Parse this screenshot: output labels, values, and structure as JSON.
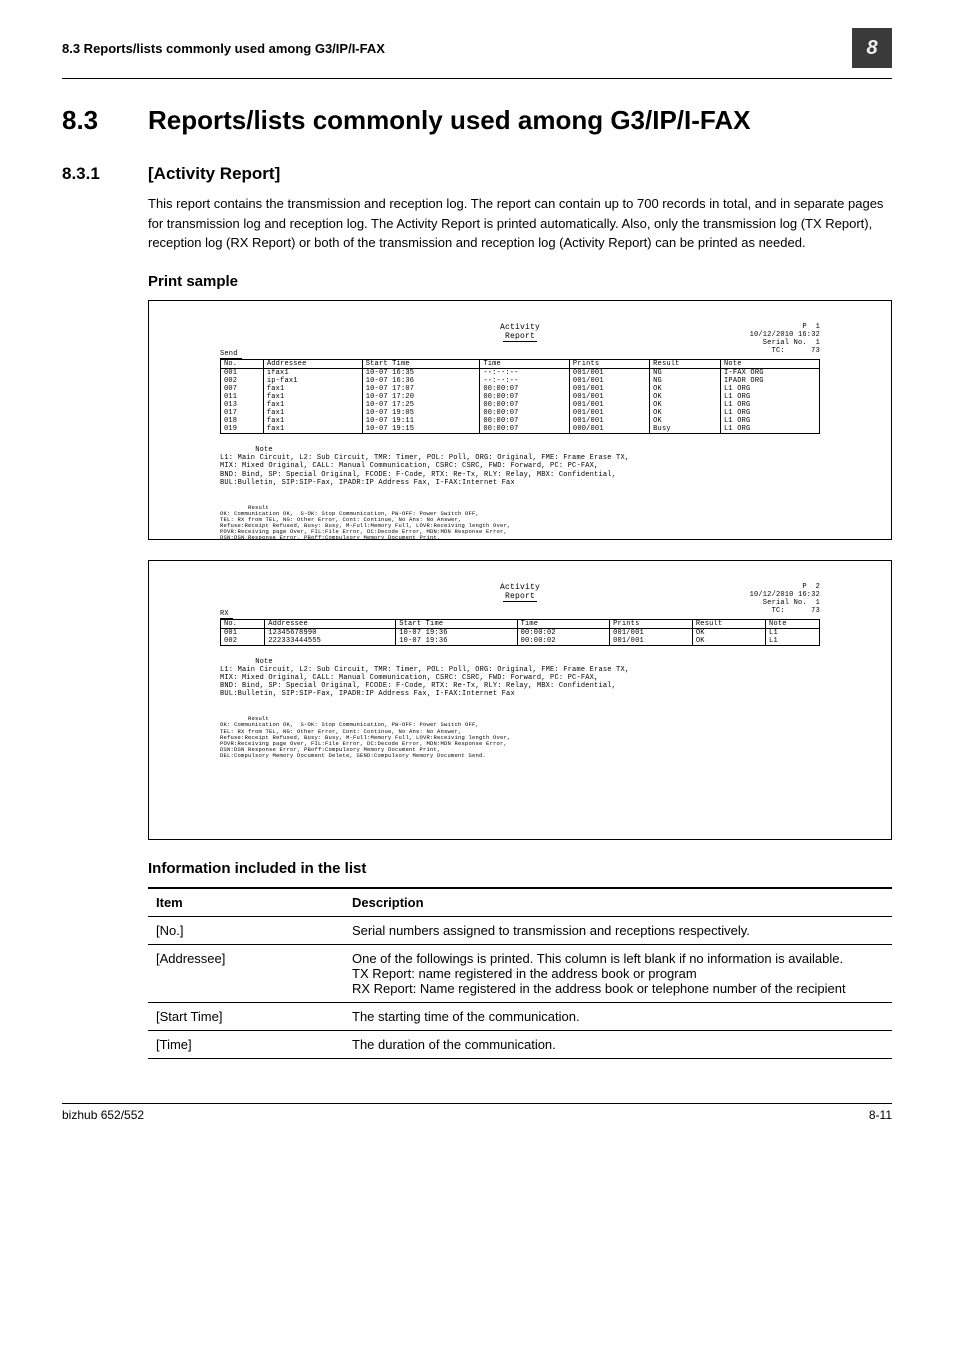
{
  "header": {
    "running": "8.3    Reports/lists commonly used among G3/IP/I-FAX",
    "chapter_box": "8"
  },
  "title": {
    "num": "8.3",
    "text": "Reports/lists commonly used among G3/IP/I-FAX"
  },
  "sub": {
    "num": "8.3.1",
    "text": "[Activity Report]"
  },
  "para1": "This report contains the transmission and reception log. The report can contain up to 700 records in total, and in separate pages for transmission log and reception log. The Activity Report is printed automatically. Also, only the transmission log (TX Report), reception log (RX Report) or both of the transmission and reception log (Activity Report) can be printed as needed.",
  "print_sample_heading": "Print sample",
  "report_common": {
    "title_top": "Activity",
    "title_bottom": "Report",
    "legend_note": "L1: Main Circuit, L2: Sub Circuit, TMR: Timer, POL: Poll, ORG: Original, FME: Frame Erase TX,\nMIX: Mixed Original, CALL: Manual Communication, CSRC: CSRC, FWD: Forward, PC: PC-FAX,\nBND: Bind, SP: Special Original, FCODE: F-Code, RTX: Re-Tx, RLY: Relay, MBX: Confidential,\nBUL:Bulletin, SIP:SIP-Fax, IPADR:IP Address Fax, I-FAX:Internet Fax",
    "legend_result": "OK: Communication OK,  S-OK: Stop Communication, PW-OFF: Power Switch OFF,\nTEL: RX from TEL, NG: Other Error, Cont: Continue, No Ans: No Answer,\nRefuse:Receipt Refused, Busy: Busy, M-Full:Memory Full, LOVR:Receiving length Over,\nPOVR:Receiving page Over, FIL:File Error, DC:Decode Error, MDN:MDN Response Error,\nDSN:DSN Response Error, PBoff:Compulsory Memory Document Print,\nDEL:Compulsory Memory Document Delete, SEND:Compulsory Memory Document Send.",
    "cols": [
      "No.",
      "Addressee",
      "Start Time",
      "Time",
      "Prints",
      "Result",
      "Note"
    ],
    "note_label": "Note",
    "result_label": "Result"
  },
  "report1": {
    "meta": "P  1\n10/12/2010 16:32\nSerial No.  1\nTC:      73",
    "section": "Send",
    "rows": [
      {
        "no": "001",
        "addr": "ifax1",
        "start": "10-07 16:35",
        "time": "--:--:--",
        "prints": "001/001",
        "result": "NG",
        "note": "I-FAX ORG"
      },
      {
        "no": "002",
        "addr": "ip-fax1",
        "start": "10-07 16:36",
        "time": "--:--:--",
        "prints": "001/001",
        "result": "NG",
        "note": "IPADR ORG"
      },
      {
        "no": "007",
        "addr": "fax1",
        "start": "10-07 17:07",
        "time": "00:00:07",
        "prints": "001/001",
        "result": "OK",
        "note": "L1 ORG"
      },
      {
        "no": "011",
        "addr": "fax1",
        "start": "10-07 17:20",
        "time": "00:00:07",
        "prints": "001/001",
        "result": "OK",
        "note": "L1 ORG"
      },
      {
        "no": "013",
        "addr": "fax1",
        "start": "10-07 17:25",
        "time": "00:00:07",
        "prints": "001/001",
        "result": "OK",
        "note": "L1 ORG"
      },
      {
        "no": "017",
        "addr": "fax1",
        "start": "10-07 19:05",
        "time": "00:00:07",
        "prints": "001/001",
        "result": "OK",
        "note": "L1 ORG"
      },
      {
        "no": "018",
        "addr": "fax1",
        "start": "10-07 19:11",
        "time": "00:00:07",
        "prints": "001/001",
        "result": "OK",
        "note": "L1 ORG"
      },
      {
        "no": "019",
        "addr": "fax1",
        "start": "10-07 19:15",
        "time": "00:00:07",
        "prints": "000/001",
        "result": "Busy",
        "note": "L1 ORG"
      }
    ]
  },
  "report2": {
    "meta": "P  2\n10/12/2010 16:32\nSerial No.  1\nTC:      73",
    "section": "RX",
    "rows": [
      {
        "no": "001",
        "addr": "12345678990",
        "start": "10-07 19:36",
        "time": "00:00:02",
        "prints": "001/001",
        "result": "OK",
        "note": "L1"
      },
      {
        "no": "002",
        "addr": "222333444555",
        "start": "10-07 19:36",
        "time": "00:00:02",
        "prints": "001/001",
        "result": "OK",
        "note": "L1"
      }
    ]
  },
  "info_heading": "Information included in the list",
  "info_table": {
    "head_item": "Item",
    "head_desc": "Description",
    "rows": [
      {
        "item": "[No.]",
        "desc": "Serial numbers assigned to transmission and receptions respectively."
      },
      {
        "item": "[Addressee]",
        "desc": "One of the followings is printed. This column is left blank if no information is available.\nTX Report: name registered in the address book or program\nRX Report: Name registered in the address book or telephone number of the recipient"
      },
      {
        "item": "[Start Time]",
        "desc": "The starting time of the communication."
      },
      {
        "item": "[Time]",
        "desc": "The duration of the communication."
      }
    ]
  },
  "footer": {
    "left": "bizhub 652/552",
    "right": "8-11"
  }
}
